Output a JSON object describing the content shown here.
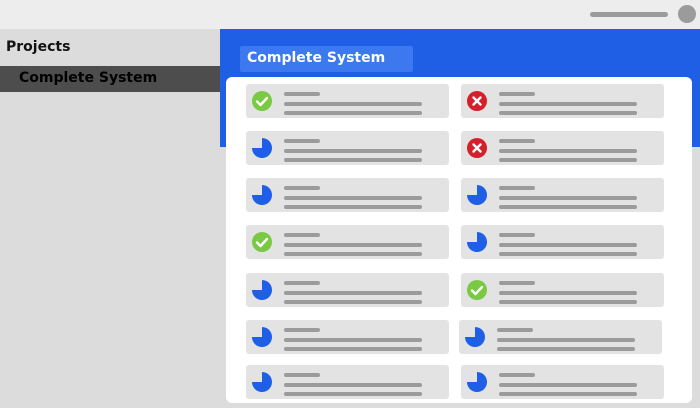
{
  "sidebar": {
    "heading": "Projects",
    "items": [
      {
        "label": "Complete System"
      }
    ]
  },
  "main": {
    "title": "Complete System",
    "tasks": [
      {
        "status": "complete"
      },
      {
        "status": "failed"
      },
      {
        "status": "in-progress"
      },
      {
        "status": "failed"
      },
      {
        "status": "in-progress"
      },
      {
        "status": "in-progress"
      },
      {
        "status": "complete"
      },
      {
        "status": "in-progress"
      },
      {
        "status": "in-progress"
      },
      {
        "status": "complete"
      },
      {
        "status": "in-progress"
      },
      {
        "status": "in-progress"
      },
      {
        "status": "in-progress"
      },
      {
        "status": "in-progress"
      }
    ]
  },
  "colors": {
    "accent": "#1f5fe6",
    "success": "#7ac943",
    "error": "#d5202b",
    "progress": "#1f5fe6"
  }
}
